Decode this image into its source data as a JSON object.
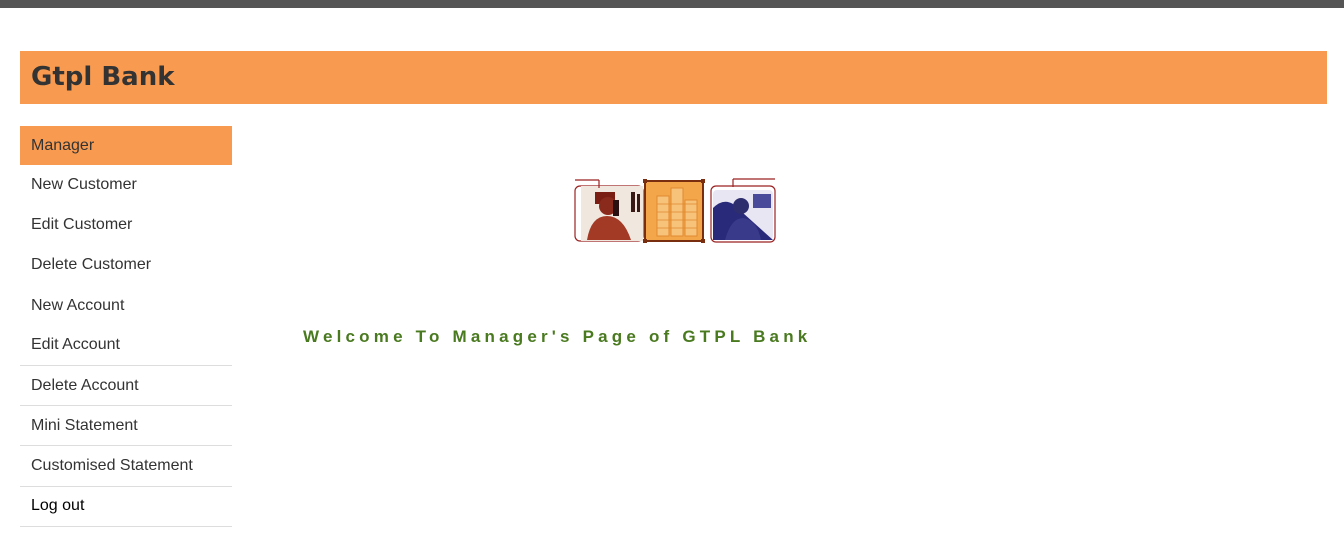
{
  "header": {
    "title": "Gtpl Bank"
  },
  "sidebar": {
    "items": [
      {
        "label": "Manager"
      },
      {
        "label": "New Customer"
      },
      {
        "label": "Edit Customer"
      },
      {
        "label": "Delete Customer"
      },
      {
        "label": "New Account"
      },
      {
        "label": "Edit Account"
      },
      {
        "label": "Delete Account"
      },
      {
        "label": "Mini Statement"
      },
      {
        "label": "Customised Statement"
      },
      {
        "label": "Log out"
      }
    ]
  },
  "main": {
    "welcome": "Welcome To Manager's Page of GTPL Bank"
  },
  "colors": {
    "accent": "#f89b50",
    "welcome_text": "#4a7a20",
    "top_bar": "#555555"
  }
}
